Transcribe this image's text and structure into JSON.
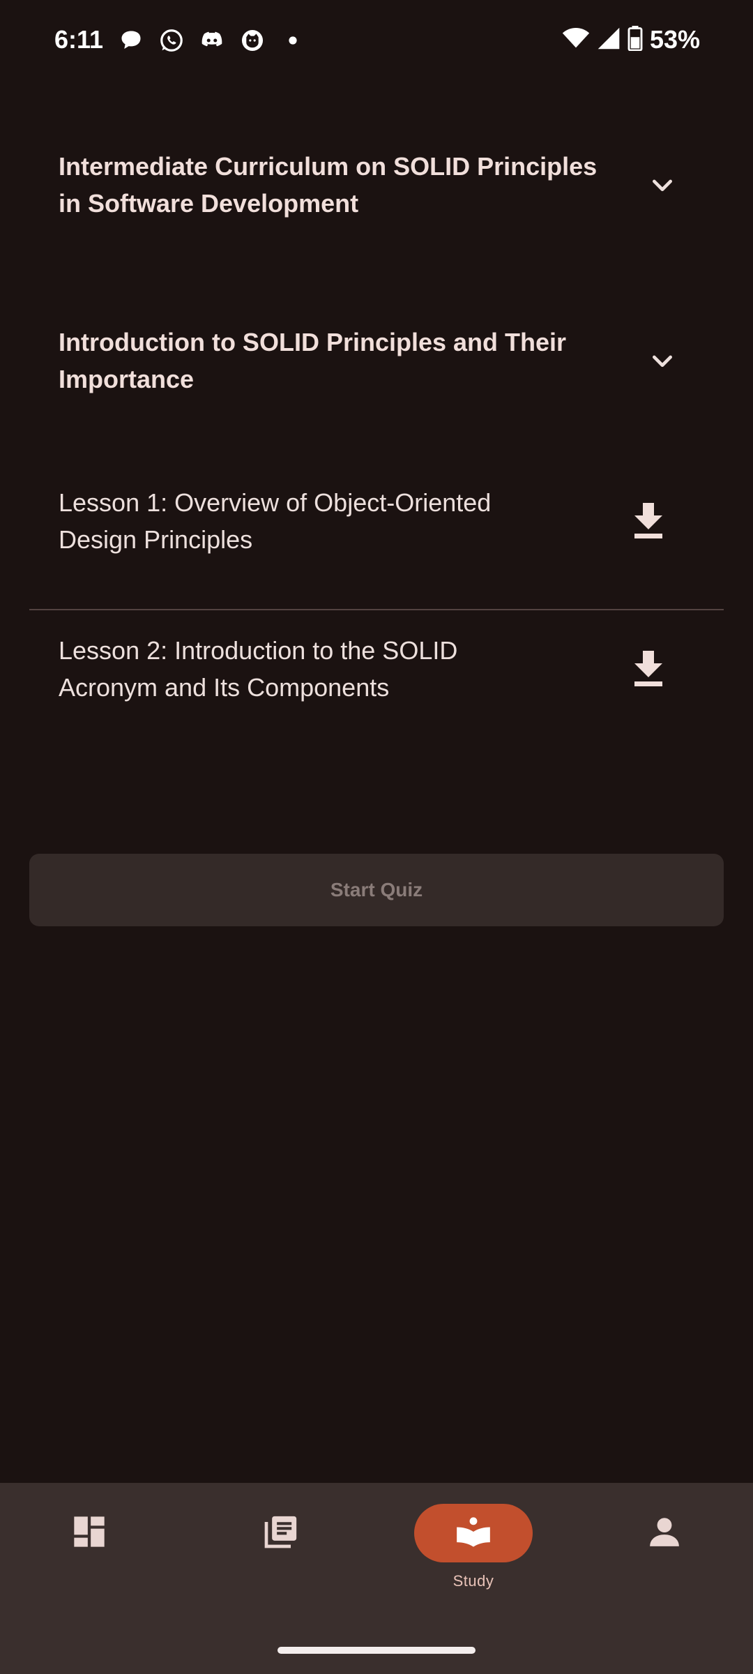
{
  "status_bar": {
    "time": "6:11",
    "battery": "53%",
    "notification_icons": [
      "chat-bubble-icon",
      "whatsapp-icon",
      "discord-icon",
      "cat-app-icon",
      "dot-icon"
    ],
    "system_icons": [
      "wifi-icon",
      "signal-icon",
      "battery-icon"
    ]
  },
  "sections": [
    {
      "title": "Intermediate Curriculum on SOLID Principles in Software Development",
      "icon": "chevron-down-icon"
    },
    {
      "title": "Introduction to SOLID Principles and Their Importance",
      "icon": "chevron-down-icon"
    }
  ],
  "lessons": [
    {
      "title": "Lesson 1: Overview of Object-Oriented Design Principles",
      "icon": "download-icon"
    },
    {
      "title": "Lesson 2: Introduction to the SOLID Acronym and Its Components",
      "icon": "download-icon"
    }
  ],
  "quiz_button": {
    "label": "Start Quiz",
    "state": "disabled"
  },
  "bottom_nav": {
    "items": [
      {
        "id": "dashboard",
        "icon": "dashboard-icon",
        "label": ""
      },
      {
        "id": "library",
        "icon": "library-icon",
        "label": ""
      },
      {
        "id": "study",
        "icon": "study-book-icon",
        "label": "Study",
        "active": true
      },
      {
        "id": "profile",
        "icon": "person-icon",
        "label": ""
      }
    ]
  },
  "colors": {
    "background": "#1b1211",
    "accent": "#c24f2d",
    "nav_background": "#3a2f2d",
    "text": "#ede0dd"
  }
}
